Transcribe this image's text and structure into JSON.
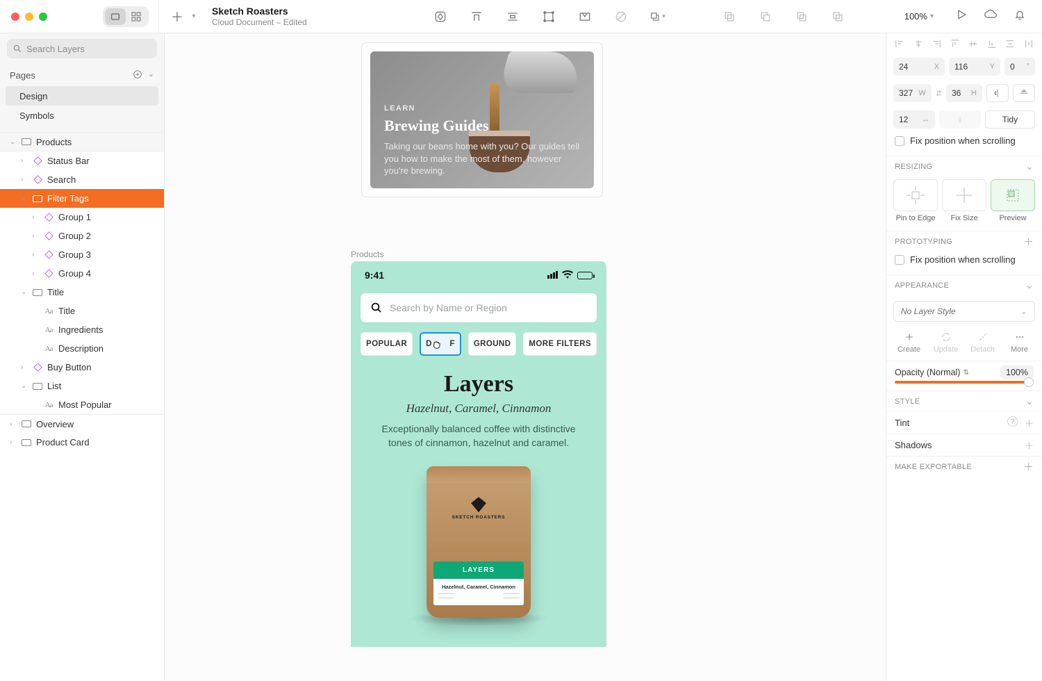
{
  "toolbar": {
    "doc_title": "Sketch Roasters",
    "doc_sub": "Cloud Document – Edited",
    "zoom": "100%"
  },
  "sidebar": {
    "search_placeholder": "Search Layers",
    "pages_label": "Pages",
    "pages": [
      "Design",
      "Symbols"
    ],
    "tree": {
      "root": "Products",
      "items": [
        {
          "name": "Status Bar",
          "type": "symbol"
        },
        {
          "name": "Search",
          "type": "symbol"
        },
        {
          "name": "Filter Tags",
          "type": "folder",
          "selected": true
        },
        {
          "name": "Group 1",
          "type": "symbol",
          "depth": 2
        },
        {
          "name": "Group 2",
          "type": "symbol",
          "depth": 2
        },
        {
          "name": "Group 3",
          "type": "symbol",
          "depth": 2
        },
        {
          "name": "Group 4",
          "type": "symbol",
          "depth": 2
        },
        {
          "name": "Title",
          "type": "folder"
        },
        {
          "name": "Title",
          "type": "text",
          "depth": 2
        },
        {
          "name": "Ingredients",
          "type": "text",
          "depth": 2
        },
        {
          "name": "Description",
          "type": "text",
          "depth": 2
        },
        {
          "name": "Buy Button",
          "type": "symbol"
        },
        {
          "name": "List",
          "type": "folder"
        },
        {
          "name": "Most Popular",
          "type": "text",
          "depth": 2
        },
        {
          "name": "Overview",
          "type": "artboard",
          "depth": 0
        },
        {
          "name": "Product Card",
          "type": "artboard",
          "depth": 0
        }
      ]
    }
  },
  "inspector": {
    "x": "24",
    "y": "116",
    "angle": "0",
    "w": "327",
    "h": "36",
    "gap": "12",
    "tidy": "Tidy",
    "fix_pos": "Fix position when scrolling",
    "resizing_hdr": "RESIZING",
    "resizing_labels": [
      "Pin to Edge",
      "Fix Size",
      "Preview"
    ],
    "proto_hdr": "PROTOTYPING",
    "fix_pos2": "Fix position when scrolling",
    "appearance_hdr": "APPEARANCE",
    "layer_style": "No Layer Style",
    "actions": [
      "Create",
      "Update",
      "Detach",
      "More"
    ],
    "opacity_label": "Opacity (Normal)",
    "opacity_value": "100",
    "opacity_suffix": "%",
    "style_hdr": "STYLE",
    "tint": "Tint",
    "shadows": "Shadows",
    "export_hdr": "MAKE EXPORTABLE"
  },
  "canvas": {
    "learn": {
      "eyebrow": "LEARN",
      "title": "Brewing Guides",
      "desc": "Taking our beans home with you? Our guides tell you how to make the most of them, however you're brewing."
    },
    "artboard_label": "Products",
    "phone": {
      "time": "9:41",
      "search_placeholder": "Search by Name or Region",
      "filters": [
        "POPULAR",
        "DECAF",
        "GROUND",
        "MORE FILTERS"
      ],
      "product_title": "Layers",
      "ingredients": "Hazelnut, Caramel, Cinnamon",
      "desc": "Exceptionally balanced coffee with distinctive tones of cinnamon, hazelnut and caramel.",
      "bag_brand": "SKETCH ROASTERS",
      "bag_label": "LAYERS",
      "bag_ingrs": "Hazelnut, Caramel, Cinnamon"
    }
  }
}
